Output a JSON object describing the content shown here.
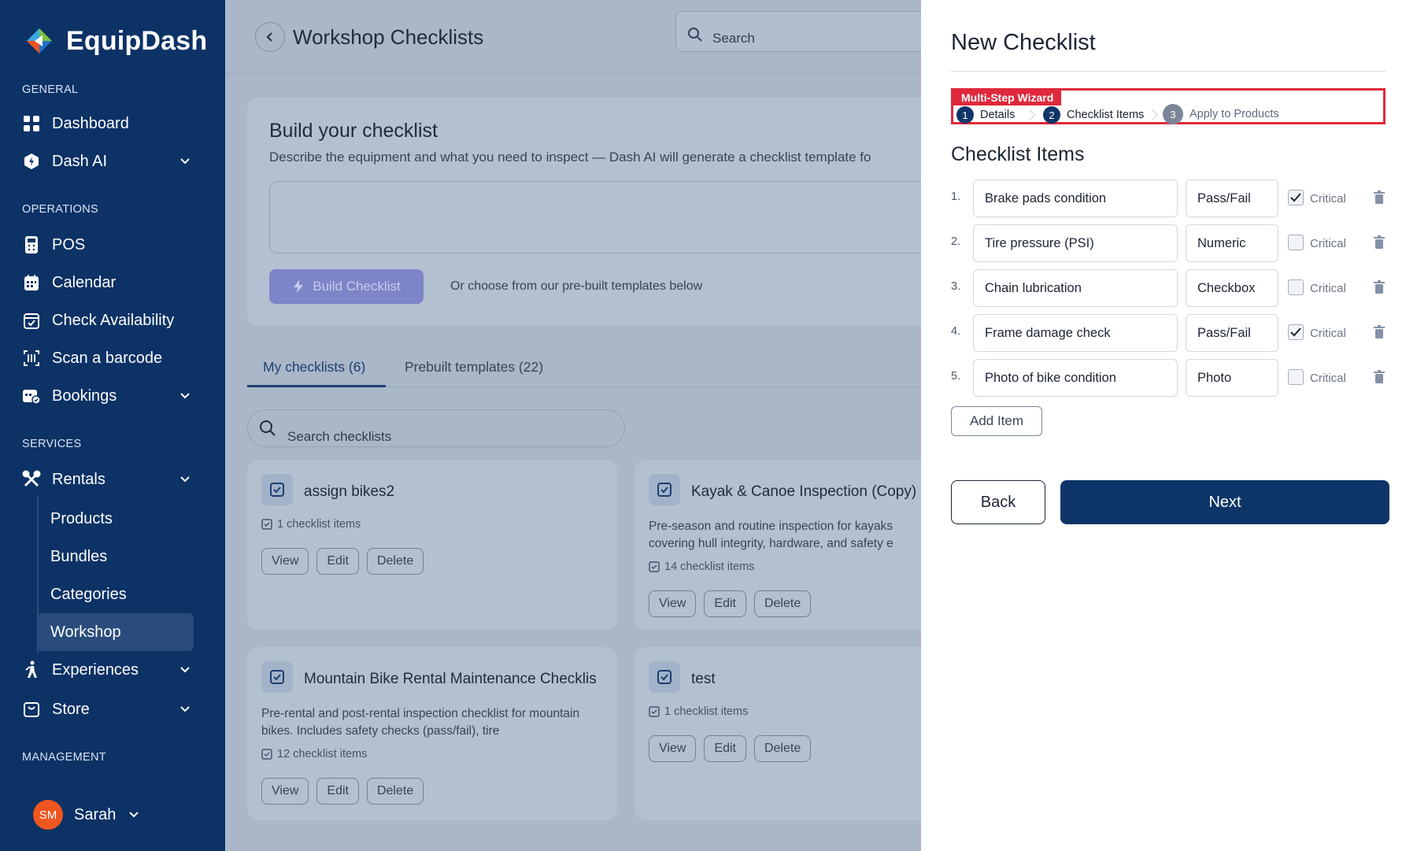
{
  "app": {
    "name": "EquipDash"
  },
  "sidebar": {
    "sections": {
      "general": "GENERAL",
      "operations": "OPERATIONS",
      "services": "SERVICES",
      "management": "MANAGEMENT"
    },
    "items": {
      "dashboard": "Dashboard",
      "dash_ai": "Dash AI",
      "pos": "POS",
      "calendar": "Calendar",
      "check_availability": "Check Availability",
      "scan_barcode": "Scan a barcode",
      "bookings": "Bookings",
      "rentals": "Rentals",
      "experiences": "Experiences",
      "store": "Store"
    },
    "rentals_sub": [
      "Products",
      "Bundles",
      "Categories",
      "Workshop"
    ],
    "active_sub": "Workshop",
    "user": {
      "initials": "SM",
      "name": "Sarah"
    }
  },
  "main": {
    "title": "Workshop Checklists",
    "search_placeholder": "Search",
    "build": {
      "title": "Build your checklist",
      "description": "Describe the equipment and what you need to inspect — Dash AI will generate a checklist template fo",
      "button": "Build Checklist",
      "or_text": "Or choose from our pre-built templates below"
    },
    "tabs": [
      "My checklists (6)",
      "Prebuilt templates (22)"
    ],
    "checklist_search_placeholder": "Search checklists",
    "cards": [
      {
        "title": "assign bikes2",
        "description": "",
        "count": "1 checklist items",
        "actions": [
          "View",
          "Edit",
          "Delete"
        ]
      },
      {
        "title": "Kayak & Canoe Inspection (Copy)",
        "description": "Pre-season and routine inspection for kayaks covering hull integrity, hardware, and safety e",
        "count": "14 checklist items",
        "actions": [
          "View",
          "Edit",
          "Delete"
        ]
      },
      {
        "title": "Mountain Bike Rental Maintenance Checklis",
        "description": "Pre-rental and post-rental inspection checklist for mountain bikes. Includes safety checks (pass/fail), tire",
        "count": "12 checklist items",
        "actions": [
          "View",
          "Edit",
          "Delete"
        ]
      },
      {
        "title": "test",
        "description": "",
        "count": "1 checklist items",
        "actions": [
          "View",
          "Edit",
          "Delete"
        ]
      }
    ]
  },
  "panel": {
    "title": "New Checklist",
    "wizard": {
      "tag": "Multi-Step Wizard",
      "steps": [
        {
          "num": "1",
          "label": "Details"
        },
        {
          "num": "2",
          "label": "Checklist Items"
        },
        {
          "num": "3",
          "label": "Apply to Products"
        }
      ]
    },
    "items_title": "Checklist Items",
    "items": [
      {
        "num": "1.",
        "name": "Brake pads condition",
        "type": "Pass/Fail",
        "critical": true,
        "critical_label": "Critical"
      },
      {
        "num": "2.",
        "name": "Tire pressure (PSI)",
        "type": "Numeric",
        "critical": false,
        "critical_label": "Critical"
      },
      {
        "num": "3.",
        "name": "Chain lubrication",
        "type": "Checkbox",
        "critical": false,
        "critical_label": "Critical"
      },
      {
        "num": "4.",
        "name": "Frame damage check",
        "type": "Pass/Fail",
        "critical": true,
        "critical_label": "Critical"
      },
      {
        "num": "5.",
        "name": "Photo of bike condition",
        "type": "Photo",
        "critical": false,
        "critical_label": "Critical"
      }
    ],
    "add_item": "Add Item",
    "back": "Back",
    "next": "Next"
  },
  "colors": {
    "sidebar_bg": "#0c3266",
    "primary": "#0e3568",
    "wizard_highlight": "#e0283b",
    "avatar": "#f0561f"
  }
}
